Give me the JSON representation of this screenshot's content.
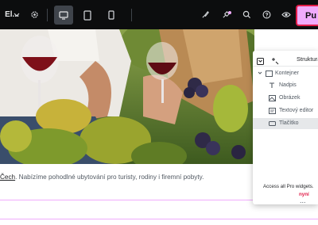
{
  "topbar": {
    "site_name": "El...",
    "publish_label": "Pu",
    "icons": [
      "chevron-down-icon",
      "gear-icon",
      "desktop-icon",
      "tablet-icon",
      "mobile-icon",
      "brush-icon",
      "notifications-icon",
      "search-icon",
      "help-icon",
      "preview-eye-icon"
    ],
    "accent_color": "#f0abfc",
    "highlight_color": "#e11d48"
  },
  "content": {
    "text_link": "Čech",
    "text_rest": ". Nabízíme pohodlné ubytování pro turisty, rodiny i firemní pobyty."
  },
  "structure_panel": {
    "title": "Struktura",
    "items": [
      {
        "label": "Kontejner",
        "icon": "container-icon"
      },
      {
        "label": "Nadpis",
        "icon": "heading-icon"
      },
      {
        "label": "Obrázek",
        "icon": "image-icon"
      },
      {
        "label": "Textový editor",
        "icon": "text-editor-icon"
      },
      {
        "label": "Tlačítko",
        "icon": "button-icon"
      }
    ],
    "promo_text": "Access all Pro widgets.",
    "promo_link": "nyní",
    "more": "..."
  }
}
